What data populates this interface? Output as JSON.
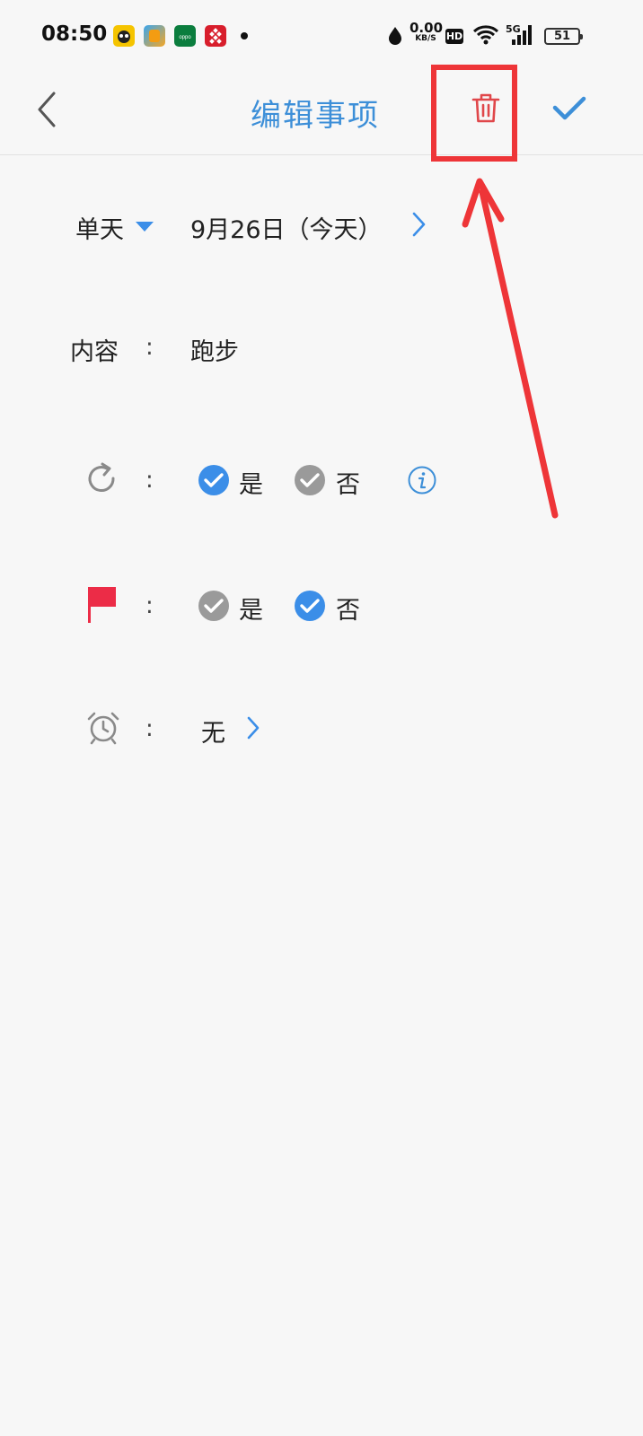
{
  "status_bar": {
    "time": "08:50",
    "net_speed_value": "0.00",
    "net_speed_unit": "KB/S",
    "hd_badge": "HD",
    "network_label": "5G",
    "battery_level": "51",
    "app_icons": [
      "game-app-icon",
      "store-app-icon",
      "oppo-app-icon",
      "red-app-icon"
    ]
  },
  "header": {
    "title": "编辑事项"
  },
  "date_row": {
    "mode_label": "单天",
    "date_value": "9月26日（今天）"
  },
  "content_row": {
    "label": "内容",
    "colon": ":",
    "value": "跑步"
  },
  "repeat_row": {
    "colon": ":",
    "yes_label": "是",
    "no_label": "否",
    "selected": "yes"
  },
  "flag_row": {
    "colon": ":",
    "yes_label": "是",
    "no_label": "否",
    "selected": "no"
  },
  "alarm_row": {
    "colon": ":",
    "value": "无"
  },
  "colors": {
    "accent": "#3d8fd8",
    "checked": "#3b8ee8",
    "unchecked": "#9a9a9a",
    "delete": "#e0474a",
    "flag": "#ec2c47",
    "annotation": "#ee3538",
    "background": "#f7f7f7"
  }
}
